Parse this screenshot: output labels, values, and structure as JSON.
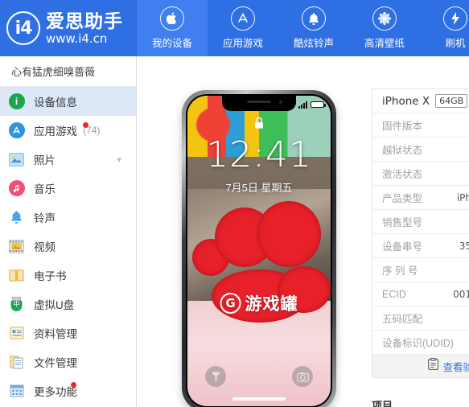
{
  "header": {
    "logo": {
      "mark": "i4",
      "name": "爱思助手",
      "url": "www.i4.cn"
    },
    "tabs": [
      {
        "label": "我的设备",
        "icon": "apple-icon",
        "active": true
      },
      {
        "label": "应用游戏",
        "icon": "appstore-icon",
        "active": false
      },
      {
        "label": "酷炫铃声",
        "icon": "bell-icon",
        "active": false
      },
      {
        "label": "高清壁纸",
        "icon": "flower-icon",
        "active": false
      },
      {
        "label": "刷机",
        "icon": "flash-icon",
        "active": false
      }
    ]
  },
  "sidebar": {
    "device_name": "心有猛虎细嗅蔷薇",
    "items": [
      {
        "label": "设备信息",
        "icon": "info-icon",
        "active": true,
        "count": "",
        "badge": false,
        "chevron": false
      },
      {
        "label": "应用游戏",
        "icon": "appstore-icon",
        "active": false,
        "count": "(74)",
        "badge": true,
        "chevron": false
      },
      {
        "label": "照片",
        "icon": "photo-icon",
        "active": false,
        "count": "",
        "badge": false,
        "chevron": true
      },
      {
        "label": "音乐",
        "icon": "music-icon",
        "active": false,
        "count": "",
        "badge": false,
        "chevron": false
      },
      {
        "label": "铃声",
        "icon": "bell-icon",
        "active": false,
        "count": "",
        "badge": false,
        "chevron": false
      },
      {
        "label": "视频",
        "icon": "video-icon",
        "active": false,
        "count": "",
        "badge": false,
        "chevron": false
      },
      {
        "label": "电子书",
        "icon": "book-icon",
        "active": false,
        "count": "",
        "badge": false,
        "chevron": false
      },
      {
        "label": "虚拟U盘",
        "icon": "usb-icon",
        "active": false,
        "count": "",
        "badge": false,
        "chevron": false
      },
      {
        "label": "资料管理",
        "icon": "contacts-icon",
        "active": false,
        "count": "",
        "badge": false,
        "chevron": false
      },
      {
        "label": "文件管理",
        "icon": "files-icon",
        "active": false,
        "count": "",
        "badge": false,
        "chevron": false
      },
      {
        "label": "更多功能",
        "icon": "grid-icon",
        "active": false,
        "count": "",
        "badge": true,
        "chevron": false
      }
    ]
  },
  "phone": {
    "lockscreen": {
      "time": "12:41",
      "date": "7月5日 星期五",
      "lock_icon": "lock-icon",
      "watermark": {
        "logo": "G",
        "text": "游戏罐"
      },
      "flashlight_icon": "flashlight-icon",
      "camera_icon": "camera-icon"
    }
  },
  "info": {
    "device_model": "iPhone X",
    "capacity": "64GB",
    "rows": [
      {
        "key": "固件版本",
        "value": ""
      },
      {
        "key": "越狱状态",
        "value": ""
      },
      {
        "key": "激活状态",
        "value": ""
      },
      {
        "key": "产品类型",
        "value": "iPh"
      },
      {
        "key": "销售型号",
        "value": ""
      },
      {
        "key": "设备串号",
        "value": "35"
      },
      {
        "key": "序 列 号",
        "value": ""
      },
      {
        "key": "ECID",
        "value": "001"
      },
      {
        "key": "五码匹配",
        "value": ""
      },
      {
        "key": "设备标识(UDID)",
        "value": ""
      }
    ],
    "footer_button": {
      "label": "查看验",
      "icon": "clipboard-icon"
    }
  },
  "below": {
    "text": "项目..."
  },
  "colors": {
    "header_blue": "#2f6fe4",
    "tab_active_blue": "#3f7ff0",
    "sidebar_active": "#dce8f7",
    "badge_red": "#ea2a2a",
    "link_blue": "#2f6fe4"
  }
}
